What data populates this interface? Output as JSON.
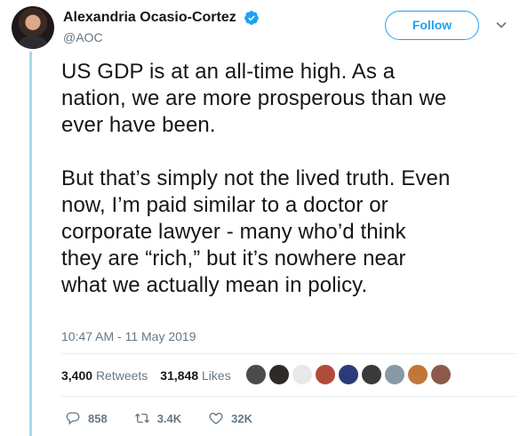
{
  "user": {
    "display_name": "Alexandria Ocasio-Cortez",
    "handle": "@AOC",
    "verified": true
  },
  "follow_label": "Follow",
  "tweet": {
    "text": "US GDP is at an all-time high. As a\nnation, we are more prosperous than we\never have been.\n\nBut that’s simply not the lived truth. Even\nnow, I’m paid similar to a doctor or\ncorporate lawyer - many who’d think\nthey are “rich,” but it’s nowhere near\nwhat we actually mean in policy."
  },
  "timestamp": "10:47 AM - 11 May 2019",
  "stats": {
    "retweets_count": "3,400",
    "retweets_label": "Retweets",
    "likes_count": "31,848",
    "likes_label": "Likes"
  },
  "liker_avatar_colors": [
    "#4a4a4a",
    "#2f2a2a",
    "#e8e8e8",
    "#b24b3a",
    "#2b3b7a",
    "#3a3a3a",
    "#8899a6",
    "#c2773a",
    "#8b5a4a"
  ],
  "actions": {
    "reply_count": "858",
    "retweet_count": "3.4K",
    "like_count": "32K"
  },
  "colors": {
    "accent": "#1da1f2",
    "secondary_text": "#657786",
    "thread_line": "#a7d8ef"
  }
}
